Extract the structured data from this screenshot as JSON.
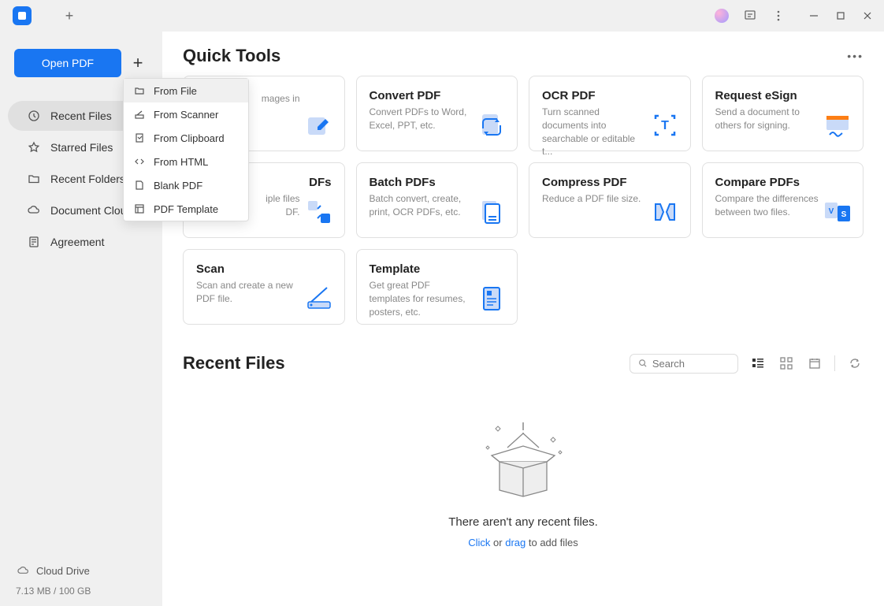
{
  "sidebar": {
    "open_button": "Open PDF",
    "items": [
      {
        "label": "Recent Files",
        "icon": "clock-icon"
      },
      {
        "label": "Starred Files",
        "icon": "star-icon"
      },
      {
        "label": "Recent Folders",
        "icon": "folder-icon"
      },
      {
        "label": "Document Cloud",
        "icon": "cloud-icon"
      },
      {
        "label": "Agreement",
        "icon": "document-icon"
      }
    ],
    "cloud_drive": "Cloud Drive",
    "storage": "7.13 MB / 100 GB"
  },
  "dropdown": {
    "items": [
      {
        "label": "From File",
        "icon": "folder-icon"
      },
      {
        "label": "From Scanner",
        "icon": "scanner-icon"
      },
      {
        "label": "From Clipboard",
        "icon": "clipboard-icon"
      },
      {
        "label": "From HTML",
        "icon": "html-icon"
      },
      {
        "label": "Blank PDF",
        "icon": "page-icon"
      },
      {
        "label": "PDF Template",
        "icon": "template-icon"
      }
    ]
  },
  "quick_tools": {
    "title": "Quick Tools",
    "cards": [
      {
        "title": "",
        "desc": "mages in"
      },
      {
        "title": "Convert PDF",
        "desc": "Convert PDFs to Word, Excel, PPT, etc."
      },
      {
        "title": "OCR PDF",
        "desc": "Turn scanned documents into searchable or editable t..."
      },
      {
        "title": "Request eSign",
        "desc": "Send a document to others for signing."
      },
      {
        "title": "DFs",
        "desc": "iple files\nDF."
      },
      {
        "title": "Batch PDFs",
        "desc": "Batch convert, create, print, OCR PDFs, etc."
      },
      {
        "title": "Compress PDF",
        "desc": "Reduce a PDF file size."
      },
      {
        "title": "Compare PDFs",
        "desc": "Compare the differences between two files."
      },
      {
        "title": "Scan",
        "desc": "Scan and create a new PDF file."
      },
      {
        "title": "Template",
        "desc": "Get great PDF templates for resumes, posters, etc."
      }
    ]
  },
  "recent": {
    "title": "Recent Files",
    "search_placeholder": "Search",
    "empty_text": "There aren't any recent files.",
    "hint_click": "Click",
    "hint_or": " or ",
    "hint_drag": "drag",
    "hint_rest": " to add files"
  }
}
